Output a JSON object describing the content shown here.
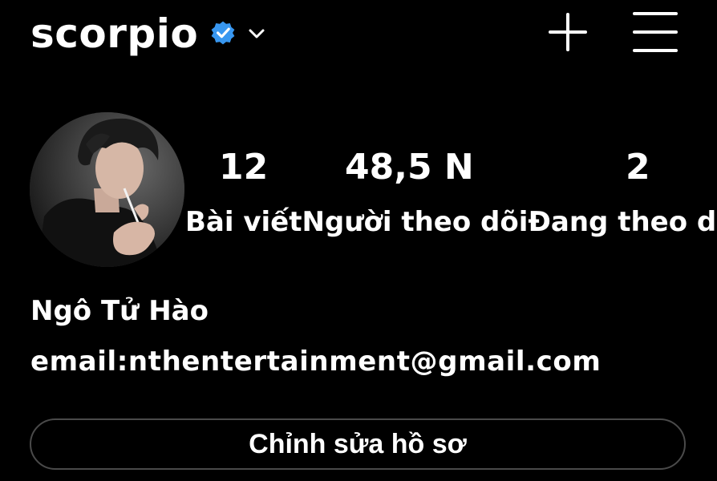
{
  "header": {
    "username": "scorpio",
    "verified_icon": "verified-badge-icon",
    "dropdown_icon": "chevron-down-icon",
    "create_icon": "plus-icon",
    "menu_icon": "hamburger-menu-icon",
    "verified_color": "#3897F0"
  },
  "profile": {
    "avatar_icon": "profile-avatar",
    "stats": {
      "posts_count": "12",
      "followers_count": "48,5 N",
      "following_count": "2",
      "labels": "Bài viếtNgười theo dõiĐang theo d"
    },
    "display_name": "Ngô Tử Hào",
    "bio": "email:nthentertainment@gmail.com",
    "edit_button_label": "Chỉnh sửa hồ sơ"
  }
}
